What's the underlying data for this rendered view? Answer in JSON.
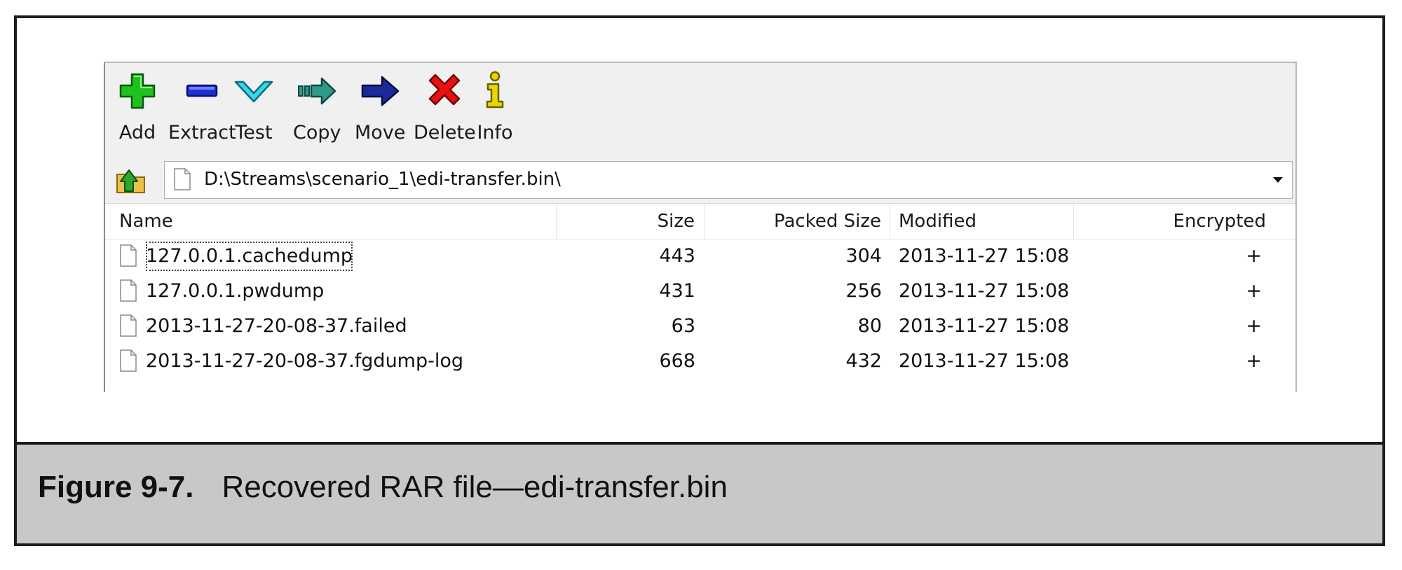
{
  "toolbar": {
    "buttons": [
      {
        "label": "Add",
        "icon": "add-icon"
      },
      {
        "label": "Extract",
        "icon": "extract-icon"
      },
      {
        "label": "Test",
        "icon": "test-icon"
      },
      {
        "label": "Copy",
        "icon": "copy-icon"
      },
      {
        "label": "Move",
        "icon": "move-icon"
      },
      {
        "label": "Delete",
        "icon": "delete-icon"
      },
      {
        "label": "Info",
        "icon": "info-icon"
      }
    ]
  },
  "address": {
    "path": "D:\\Streams\\scenario_1\\edi-transfer.bin\\"
  },
  "columns": {
    "name": "Name",
    "size": "Size",
    "packed_size": "Packed Size",
    "modified": "Modified",
    "encrypted": "Encrypted"
  },
  "files": [
    {
      "name": "127.0.0.1.cachedump",
      "size": "443",
      "packed_size": "304",
      "modified": "2013-11-27 15:08",
      "encrypted": "+"
    },
    {
      "name": "127.0.0.1.pwdump",
      "size": "431",
      "packed_size": "256",
      "modified": "2013-11-27 15:08",
      "encrypted": "+"
    },
    {
      "name": "2013-11-27-20-08-37.failed",
      "size": "63",
      "packed_size": "80",
      "modified": "2013-11-27 15:08",
      "encrypted": "+"
    },
    {
      "name": "2013-11-27-20-08-37.fgdump-log",
      "size": "668",
      "packed_size": "432",
      "modified": "2013-11-27 15:08",
      "encrypted": "+"
    }
  ],
  "caption": {
    "number": "Figure 9-7.",
    "text": "Recovered RAR file—edi-transfer.bin"
  },
  "colors": {
    "add": "#1fc11f",
    "extract": "#1d2fd6",
    "test": "#38d6e8",
    "copy": "#2e9a8a",
    "move": "#1a2a9a",
    "delete": "#e81010",
    "info": "#e8d800",
    "caption_band": "#c8c8c8"
  }
}
